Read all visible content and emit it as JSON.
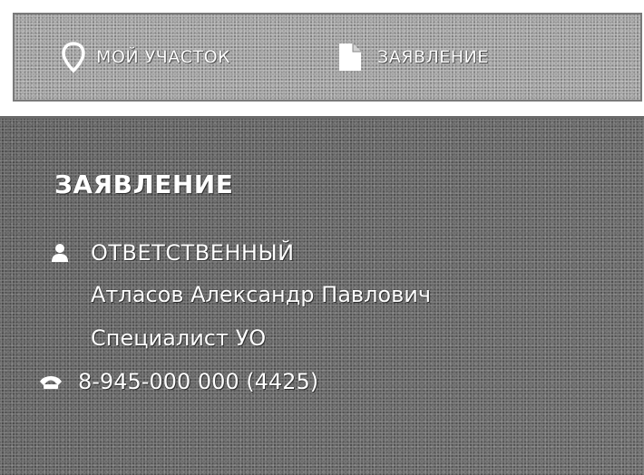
{
  "tabs": {
    "my_plot": "МОЙ УЧАСТОК",
    "application": "ЗАЯВЛЕНИЕ"
  },
  "panel": {
    "title": "ЗАЯВЛЕНИЕ",
    "responsible_label": "ОТВЕТСТВЕННЫЙ",
    "responsible_name": "Атласов Александр Павлович",
    "responsible_position": "Специалист УО",
    "phone": "8-945-000 000 (4425)"
  },
  "icons": {
    "my_plot": "map-pin-icon",
    "application": "document-icon",
    "responsible": "user-icon",
    "phone": "phone-icon"
  }
}
